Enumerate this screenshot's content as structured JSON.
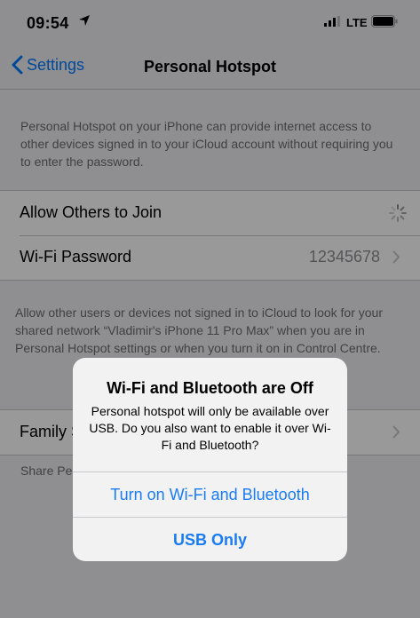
{
  "status_bar": {
    "time": "09:54",
    "network": "LTE",
    "location_icon": "location-arrow-icon",
    "signal_icon": "cellular-signal-icon",
    "battery_icon": "battery-icon"
  },
  "nav": {
    "back_label": "Settings",
    "title": "Personal Hotspot",
    "back_icon": "chevron-left-icon"
  },
  "info1": "Personal Hotspot on your iPhone can provide internet access to other devices signed in to your iCloud account without requiring you to enter the password.",
  "rows": [
    {
      "label": "Allow Others to Join",
      "value": "",
      "accessory": "spinner-icon"
    },
    {
      "label": "Wi-Fi Password",
      "value": "12345678",
      "accessory": "chevron-right-icon"
    }
  ],
  "info2": "Allow other users or devices not signed in to iCloud to look for your shared network “Vladimir's iPhone 11 Pro Max” when you are in Personal Hotspot settings or when you turn it on in Control Centre.",
  "family_row": {
    "label": "Family Sharing",
    "accessory": "chevron-right-icon"
  },
  "info3": "Share Personal Hotspot with members of Family Sharing.",
  "alert": {
    "title": "Wi-Fi and Bluetooth are Off",
    "message": "Personal hotspot will only be available over USB. Do you also want to enable it over Wi-Fi and Bluetooth?",
    "buttons": [
      "Turn on Wi-Fi and Bluetooth",
      "USB Only"
    ]
  },
  "colors": {
    "accent": "#007aff",
    "background": "#efeff4",
    "separator": "#c8c7cc"
  }
}
